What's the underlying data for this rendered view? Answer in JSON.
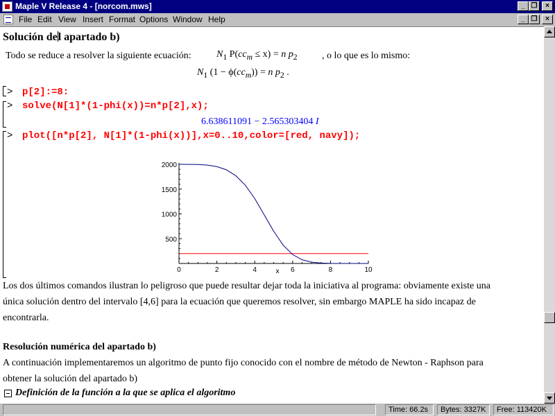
{
  "window": {
    "title": "Maple V Release 4 - [norcom.mws]",
    "controls": [
      "_",
      "❐",
      "×"
    ]
  },
  "menubar": {
    "items": [
      "File",
      "Edit",
      "View",
      "Insert",
      "Format",
      "Options",
      "Window",
      "Help"
    ]
  },
  "document": {
    "heading1_part1": "Solución de",
    "heading1_part2": "l apartado b)",
    "intro_text": "Todo se reduce a resolver la siguiente ecuación:",
    "intro_tail": ", o lo que es lo mismo:",
    "eq1": {
      "n": "N",
      "n_sub": "1",
      "p": " P(",
      "cc": "cc",
      "cc_sub": "m",
      "rel": " ≤ x) = ",
      "np": "n p",
      "np_sub": "2"
    },
    "eq2": {
      "n": "N",
      "n_sub": "1",
      "body": " (1 − ϕ(",
      "cc": "cc",
      "cc_sub": "m",
      "close": ")) = ",
      "np": "n p",
      "np_sub": "2",
      "end": " ."
    },
    "prompt": "[>",
    "cmd1": "p[2]:=8:",
    "cmd2": "solve(N[1]*(1-phi(x))=n*p[2],x);",
    "solve_output_real": "6.638611091 − 2.565303404 ",
    "solve_output_imag": "I",
    "cmd3": "plot([n*p[2], N[1]*(1-phi(x))],x=0..10,color=[red, navy]);",
    "paragraph1_line1": "Los dos últimos comandos ilustran lo peligroso que puede resultar dejar toda la iniciativa al programa: obviamente existe una",
    "paragraph1_line2": "única solución dentro del intervalo [4,6] para la ecuación que queremos resolver, sin embargo MAPLE ha sido incapaz de",
    "paragraph1_line3": "encontrarla.",
    "heading2": "Resolución numérica del apartado  b)",
    "paragraph2_line1": "A continuación implementaremos un algoritmo de punto fijo conocido con el nombre de método de Newton - Raphson para",
    "paragraph2_line2": "obtener la solución del apartado b)",
    "section_title": "Definición de la función a la que se aplica el algoritmo"
  },
  "chart_data": {
    "type": "line",
    "title": "",
    "xlabel": "x",
    "ylabel": "",
    "xlim": [
      0,
      10
    ],
    "ylim": [
      0,
      2000
    ],
    "x_ticks": [
      "0",
      "2",
      "4",
      "6",
      "8",
      "10"
    ],
    "y_ticks": [
      "500",
      "1000",
      "1500",
      "2000"
    ],
    "series": [
      {
        "color": "#ff0000",
        "x": [
          0,
          10
        ],
        "y": [
          200,
          200
        ]
      },
      {
        "color": "#000080",
        "x": [
          0,
          0.5,
          1,
          1.5,
          2,
          2.5,
          3,
          3.5,
          4,
          4.5,
          5,
          5.5,
          6,
          6.5,
          7,
          7.5,
          8,
          8.5,
          9,
          9.5,
          10
        ],
        "y": [
          2000,
          1999,
          1996,
          1985,
          1955,
          1890,
          1770,
          1580,
          1310,
          980,
          650,
          370,
          180,
          75,
          27,
          8,
          2,
          0.5,
          0,
          0,
          0
        ]
      }
    ]
  },
  "statusbar": {
    "time": "Time:  66.2s",
    "bytes": "Bytes:  3327K",
    "free": "Free:  113420K"
  }
}
